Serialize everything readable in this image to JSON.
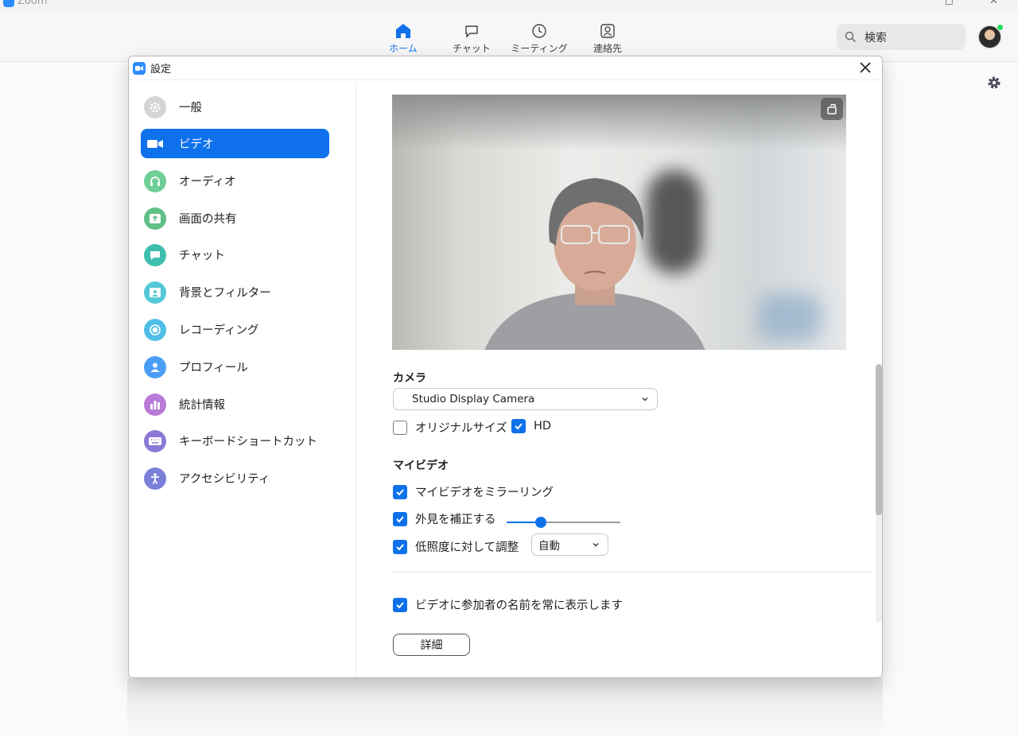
{
  "app": {
    "name": "Zoom",
    "nav": [
      {
        "label": "ホーム",
        "icon": "home-icon",
        "active": true
      },
      {
        "label": "チャット",
        "icon": "chat-icon",
        "active": false
      },
      {
        "label": "ミーティング",
        "icon": "clock-icon",
        "active": false
      },
      {
        "label": "連絡先",
        "icon": "contact-icon",
        "active": false
      }
    ],
    "search_label": "検索",
    "accent": "#0e71eb",
    "status_color": "#23d959"
  },
  "dialog": {
    "title": "設定",
    "sidebar": [
      {
        "label": "一般",
        "icon": "gear-icon",
        "color": "#d5d5d5"
      },
      {
        "label": "ビデオ",
        "icon": "video-camera-icon",
        "color": "#0e71eb",
        "active": true
      },
      {
        "label": "オーディオ",
        "icon": "headphones-icon",
        "color": "#6fcf97"
      },
      {
        "label": "画面の共有",
        "icon": "share-screen-icon",
        "color": "#5fbf85"
      },
      {
        "label": "チャット",
        "icon": "chat-bubble-icon",
        "color": "#3ebfae"
      },
      {
        "label": "背景とフィルター",
        "icon": "background-icon",
        "color": "#55c8d8"
      },
      {
        "label": "レコーディング",
        "icon": "record-icon",
        "color": "#4fbfe8"
      },
      {
        "label": "プロフィール",
        "icon": "profile-icon",
        "color": "#4a9ff5"
      },
      {
        "label": "統計情報",
        "icon": "statistics-icon",
        "color": "#b97ad7"
      },
      {
        "label": "キーボードショートカット",
        "icon": "keyboard-icon",
        "color": "#8b78d6"
      },
      {
        "label": "アクセシビリティ",
        "icon": "accessibility-icon",
        "color": "#7a7fd8"
      }
    ],
    "video": {
      "camera_label": "カメラ",
      "camera_value": "Studio Display Camera",
      "original_size_label": "オリジナルサイズ",
      "original_size_checked": false,
      "hd_label": "HD",
      "hd_checked": true,
      "my_video_label": "マイビデオ",
      "mirror_label": "マイビデオをミラーリング",
      "mirror_checked": true,
      "touch_up_label": "外見を補正する",
      "touch_up_checked": true,
      "touch_up_level": 0.28,
      "low_light_label": "低照度に対して調整",
      "low_light_checked": true,
      "low_light_value": "自動",
      "show_names_label": "ビデオに参加者の名前を常に表示します",
      "show_names_checked": true,
      "advanced_label": "詳細"
    }
  }
}
